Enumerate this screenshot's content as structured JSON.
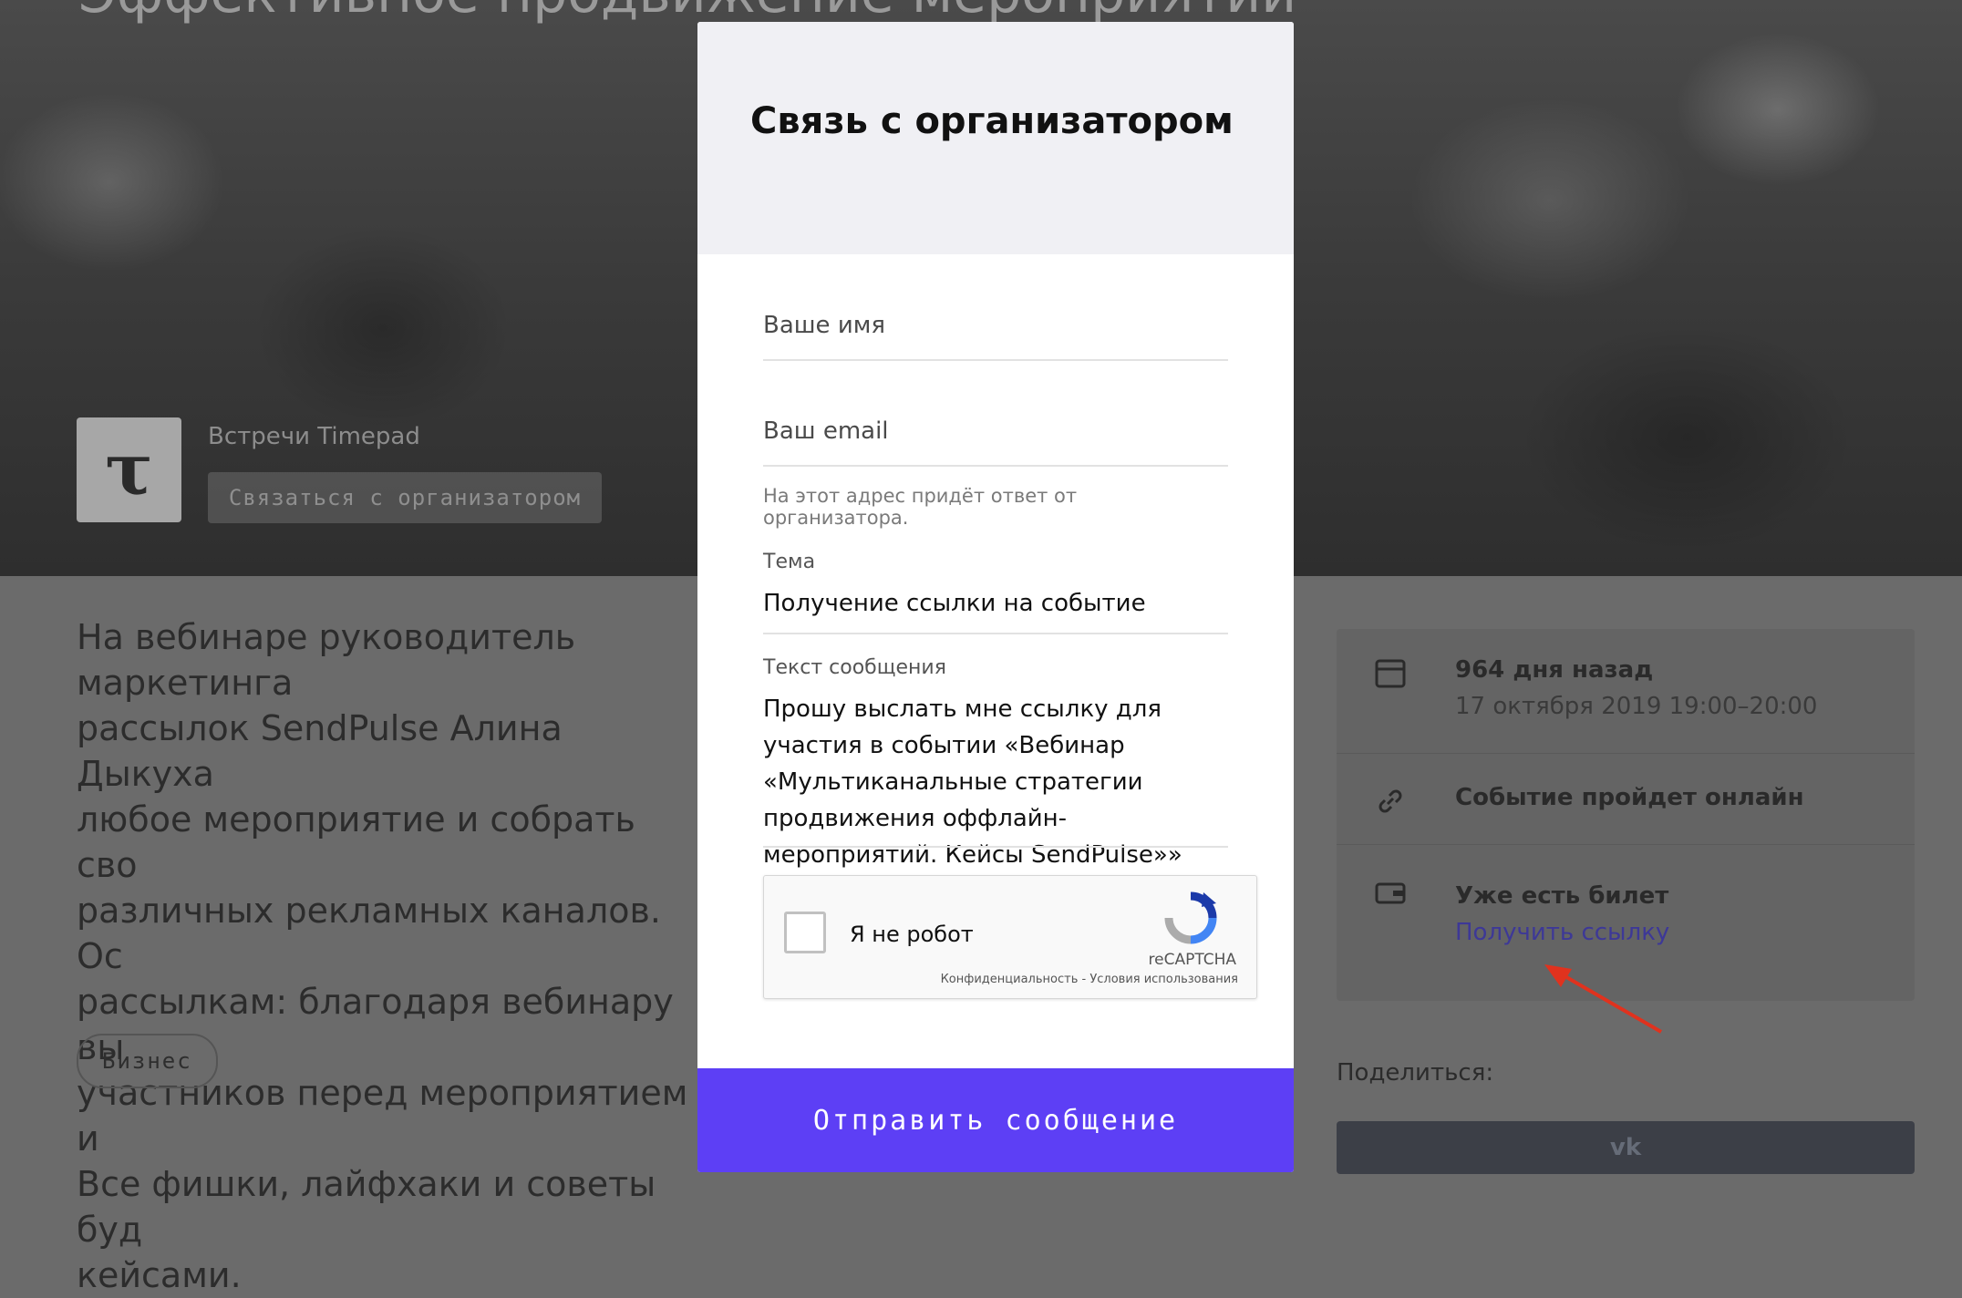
{
  "background": {
    "hero_title": "Эффективное продвижение мероприятий",
    "organizer": {
      "logo_letter": "τ",
      "name": "Встречи Timepad",
      "contact_button": "Связаться с организатором"
    },
    "description": "На вебинаре руководитель маркетинга\nрассылок SendPulse Алина Дыкуха\nлюбое мероприятие и собрать сво\nразличных рекламных каналов. Ос\nрассылкам: благодаря вебинару вы\nучастников перед мероприятием и\nВсе фишки, лайфхаки и советы буд\nкейсами.",
    "tag": "Бизнес",
    "info": {
      "date_title": "964 дня назад",
      "date_sub": "17 октября 2019 19:00–20:00",
      "online": "Событие пройдет онлайн",
      "ticket_title": "Уже есть билет",
      "ticket_link": "Получить ссылку"
    },
    "share_label": "Поделиться:",
    "share_vk": "vk",
    "colors": {
      "arrow": "#e0321e"
    }
  },
  "modal": {
    "title": "Связь с организатором",
    "name_placeholder": "Ваше имя",
    "email_placeholder": "Ваш email",
    "email_hint": "На этот адрес придёт ответ от организатора.",
    "topic_label": "Тема",
    "topic_value": "Получение ссылки на событие",
    "message_label": "Текст сообщения",
    "message_value": "Прошу выслать мне ссылку для участия в событии «Вебинар «Мультиканальные стратегии продвижения оффлайн-мероприятий. Кейсы SendPulse»»",
    "captcha": {
      "label": "Я не робот",
      "brand": "reCAPTCHA",
      "links": "Конфиденциальность - Условия использования"
    },
    "submit": "Отправить сообщение",
    "colors": {
      "submit_bg": "#5d3ff5",
      "header_bg": "#f0f0f4"
    }
  }
}
